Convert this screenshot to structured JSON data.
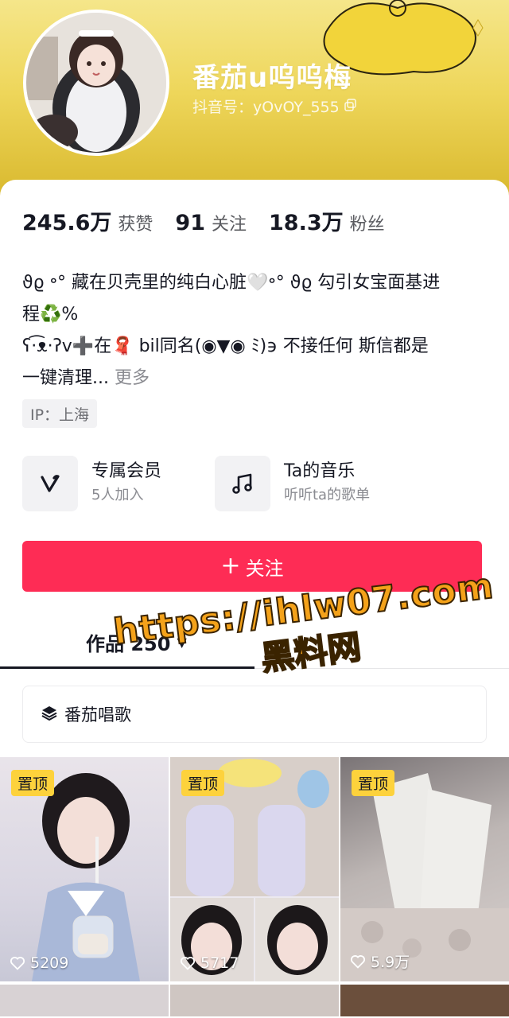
{
  "profile": {
    "nickname": "番茄u呜呜梅",
    "account_id": "抖音号：yOvOY_555"
  },
  "stats": {
    "likes_value": "245.6万",
    "likes_label": "获赞",
    "following_value": "91",
    "following_label": "关注",
    "followers_value": "18.3万",
    "followers_label": "粉丝"
  },
  "bio": {
    "line1": "ϑϱ ॰° 藏在贝壳里的纯白心脏🤍॰° ϑϱ  勾引女宝面基进",
    "line2": "程♻️%",
    "line3": "ʕ·͡ᴥ·ʔv➕在🧣 bil同名(◉▼◉ ﾐ)϶  不接任何 斯信都是",
    "line4": "一键清理...",
    "more": " 更多"
  },
  "ip_tag": "IP：上海",
  "features": {
    "membership_title": "专属会员",
    "membership_sub": "5人加入",
    "music_title": "Ta的音乐",
    "music_sub": "听听ta的歌单"
  },
  "follow_button": {
    "plus": "+",
    "label": "关注"
  },
  "tabs": {
    "works_label": "作品 250"
  },
  "collection": {
    "label": "番茄唱歌"
  },
  "videos": [
    {
      "pinned": "置顶",
      "likes": "5209"
    },
    {
      "pinned": "置顶",
      "likes": "5717"
    },
    {
      "pinned": "置顶",
      "likes": "5.9万"
    }
  ],
  "watermark": {
    "url": "https://ihlw07.com",
    "name": "黑料网"
  },
  "colors": {
    "banner_yellow": "#eed65a",
    "follow_red": "#fe2c55",
    "pin_yellow": "#fdd23c",
    "watermark_orange": "#f4a21a"
  },
  "icons": [
    "copy-icon",
    "membership-v-icon",
    "music-note-icon",
    "caret-down-icon",
    "layers-icon",
    "heart-icon"
  ]
}
